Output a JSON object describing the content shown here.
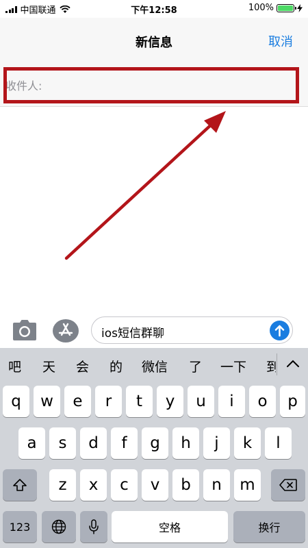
{
  "status_bar": {
    "carrier": "中国联通",
    "time": "下午12:58",
    "battery": "100%",
    "battery_level": 1.0,
    "icons": [
      "signal-bars-icon",
      "wifi-icon",
      "battery-icon",
      "charging-bolt-icon"
    ]
  },
  "nav": {
    "title": "新信息",
    "cancel": "取消"
  },
  "recipient": {
    "label": "收件人:"
  },
  "compose": {
    "text": "ios短信群聊",
    "icons": [
      "camera-icon",
      "app-store-icon",
      "send-arrow-icon"
    ]
  },
  "keyboard": {
    "candidates": [
      "吧",
      "天",
      "会",
      "的",
      "微信",
      "了",
      "一下",
      "到"
    ],
    "row1": [
      "q",
      "w",
      "e",
      "r",
      "t",
      "y",
      "u",
      "i",
      "o",
      "p"
    ],
    "row2": [
      "a",
      "s",
      "d",
      "f",
      "g",
      "h",
      "j",
      "k",
      "l"
    ],
    "row3": [
      "z",
      "x",
      "c",
      "v",
      "b",
      "n",
      "m"
    ],
    "numbers_label": "123",
    "space_label": "空格",
    "return_label": "换行",
    "icons": [
      "shift-icon",
      "delete-icon",
      "globe-icon",
      "microphone-icon",
      "collapse-chevron-icon"
    ]
  },
  "colors": {
    "accent": "#1a7de0",
    "highlight": "#b3151a",
    "keyboard_bg": "#d1d4d9",
    "battery_fill": "#4cd964"
  }
}
